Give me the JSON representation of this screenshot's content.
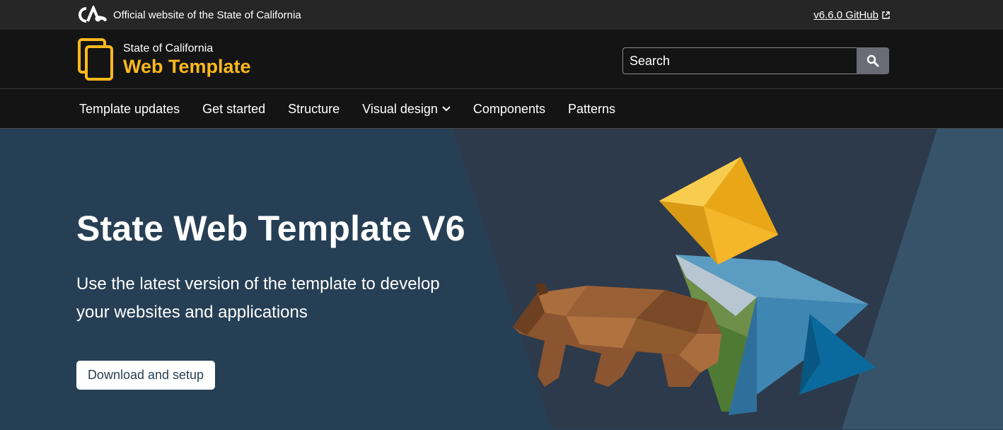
{
  "utility": {
    "official_text": "Official website of the State of California",
    "github_link": "v6.6.0 GitHub"
  },
  "branding": {
    "state_name": "State of California",
    "site_name": "Web Template",
    "brand_color": "#fdb81e"
  },
  "search": {
    "placeholder": "Search",
    "button_icon": "search-icon"
  },
  "nav": {
    "items": [
      {
        "label": "Template updates"
      },
      {
        "label": "Get started"
      },
      {
        "label": "Structure"
      },
      {
        "label": "Visual design",
        "has_dropdown": true
      },
      {
        "label": "Components"
      },
      {
        "label": "Patterns"
      }
    ]
  },
  "hero": {
    "title": "State Web Template V6",
    "subtitle": "Use the latest version of the template to develop your websites and applications",
    "button": "Download and setup",
    "image": "low-poly-bear-illustration"
  },
  "colors": {
    "utility_bg": "#262626",
    "header_bg": "#141414",
    "hero_bg": "#263f55",
    "accent": "#fdb81e"
  }
}
